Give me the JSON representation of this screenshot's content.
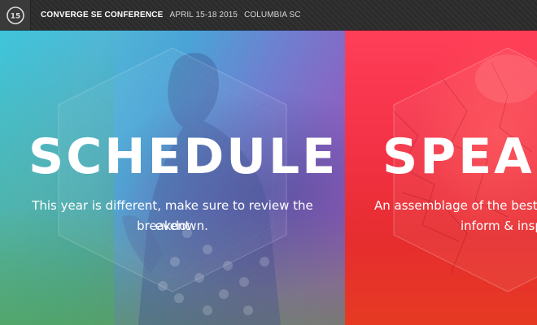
{
  "header": {
    "logo_text": "15",
    "title": "CONVERGE SE CONFERENCE",
    "dates": "APRIL 15-18 2015",
    "location": "COLUMBIA SC"
  },
  "panels": {
    "schedule": {
      "heading": "SCHEDULE",
      "description_line1": "This year is different, make sure to review the event",
      "description_line2": "breakdown."
    },
    "speakers": {
      "heading": "SPEAK",
      "description_line1": "An assemblage of the best spe",
      "description_line2": "inform & inspi"
    }
  },
  "colors": {
    "topbar": "#2b2b2b",
    "schedule_start": "#3fc6dc",
    "schedule_end": "#9f54b9",
    "speakers": "#f33246"
  },
  "icons": [
    "converge-logo-icon"
  ]
}
